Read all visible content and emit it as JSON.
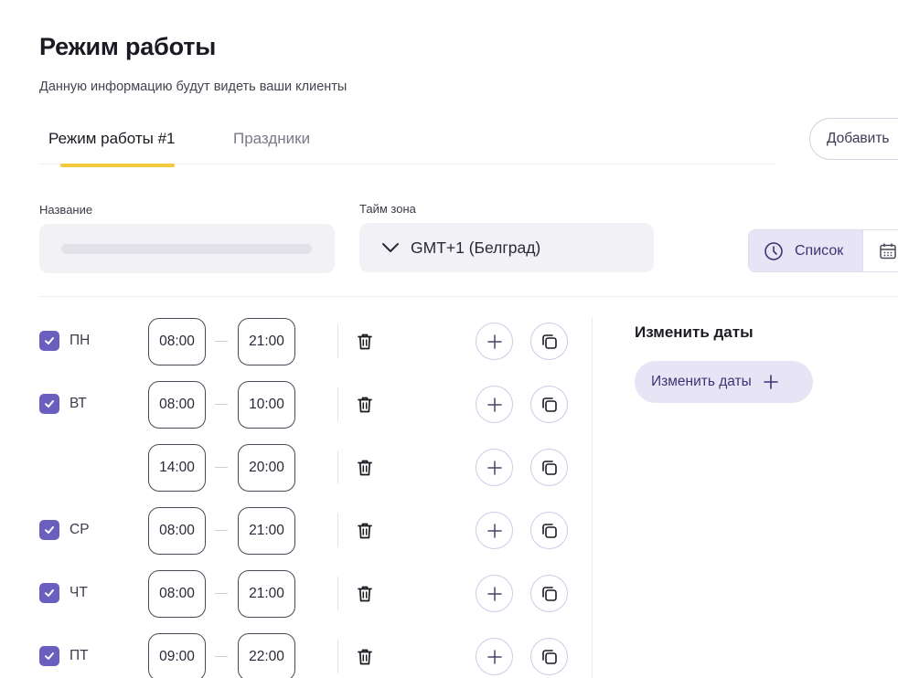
{
  "header": {
    "title": "Режим работы",
    "subtitle": "Данную информацию будут видеть ваши клиенты"
  },
  "tabs": [
    {
      "label": "Режим работы #1",
      "active": true
    },
    {
      "label": "Праздники",
      "active": false
    }
  ],
  "add_button": {
    "label": "Добавить"
  },
  "form": {
    "name_label": "Название",
    "name_value": "",
    "timezone_label": "Тайм зона",
    "timezone_value": "GMT+1 (Белград)"
  },
  "view_toggle": {
    "list_label": "Список",
    "selected": "list",
    "icons": [
      "clock-icon",
      "calendar-icon"
    ]
  },
  "schedule": {
    "rows": [
      {
        "day": "ПН",
        "checked": true,
        "from": "08:00",
        "to": "21:00"
      },
      {
        "day": "ВТ",
        "checked": true,
        "from": "08:00",
        "to": "10:00"
      },
      {
        "day": "",
        "checked": false,
        "from": "14:00",
        "to": "20:00"
      },
      {
        "day": "СР",
        "checked": true,
        "from": "08:00",
        "to": "21:00"
      },
      {
        "day": "ЧТ",
        "checked": true,
        "from": "08:00",
        "to": "21:00"
      },
      {
        "day": "ПТ",
        "checked": true,
        "from": "09:00",
        "to": "22:00"
      }
    ]
  },
  "dates": {
    "title": "Изменить даты",
    "button_label": "Изменить даты"
  },
  "colors": {
    "accent": "#6a5fbf",
    "accent_soft": "#e7e5f5",
    "tab_underline": "#f4c93c",
    "input_bg": "#f2f1f6"
  }
}
